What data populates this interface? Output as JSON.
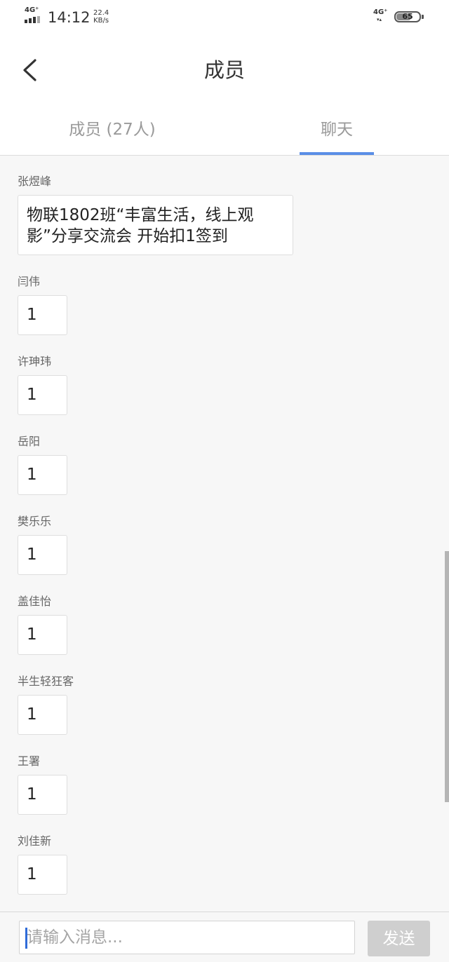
{
  "status_bar": {
    "network_left": "4G⁺",
    "time": "14:12",
    "speed_value": "22.4",
    "speed_unit": "KB/s",
    "network_right": "4G⁺",
    "data_arrows": "▾▴",
    "battery_level": "65",
    "battery_fraction": 0.65
  },
  "header": {
    "title": "成员",
    "back_icon": "chevron-left-icon"
  },
  "tabs": [
    {
      "label": "成员 (27人)",
      "active": false
    },
    {
      "label": "聊天",
      "active": true
    }
  ],
  "colors": {
    "accent": "#5a8ee6",
    "send_button_disabled": "#cfcfcf",
    "caret": "#2f6bd8"
  },
  "messages": [
    {
      "sender": "张煜峰",
      "text": "物联1802班“丰富生活，线上观影”分享交流会 开始扣1签到"
    },
    {
      "sender": "闫伟",
      "text": "1"
    },
    {
      "sender": "许珅玮",
      "text": "1"
    },
    {
      "sender": "岳阳",
      "text": "1"
    },
    {
      "sender": "樊乐乐",
      "text": "1"
    },
    {
      "sender": "盖佳怡",
      "text": "1"
    },
    {
      "sender": "半生轻狂客",
      "text": "1"
    },
    {
      "sender": "王署",
      "text": "1"
    },
    {
      "sender": "刘佳新",
      "text": "1"
    }
  ],
  "composer": {
    "placeholder": "请输入消息...",
    "value": "",
    "send_label": "发送"
  }
}
